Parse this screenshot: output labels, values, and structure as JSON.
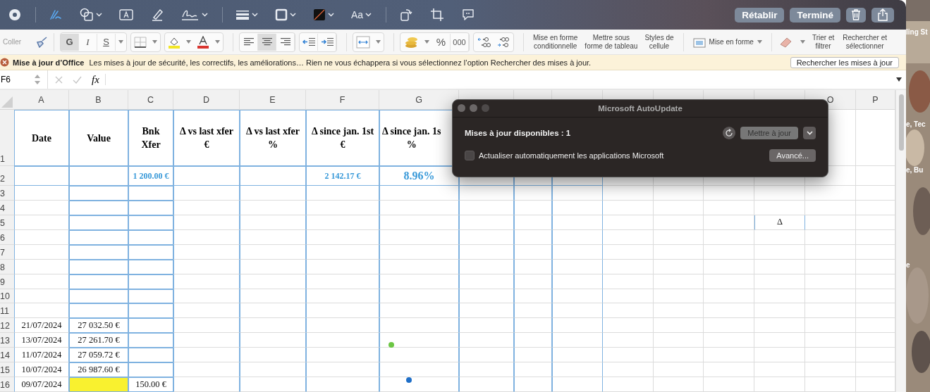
{
  "markup_toolbar": {
    "tools": [
      {
        "kind": "target",
        "selected": false,
        "menu": false
      },
      {
        "kind": "pen",
        "selected": true,
        "menu": false
      },
      {
        "kind": "shapes",
        "selected": false,
        "menu": true
      },
      {
        "kind": "textbox",
        "selected": false,
        "menu": false
      },
      {
        "kind": "highlighter",
        "selected": false,
        "menu": false
      },
      {
        "kind": "signature",
        "selected": false,
        "menu": true
      },
      {
        "kind": "line-weight",
        "selected": false,
        "menu": true
      },
      {
        "kind": "border",
        "selected": false,
        "menu": true
      },
      {
        "kind": "fill",
        "selected": false,
        "menu": true
      },
      {
        "kind": "font",
        "label": "Aa",
        "selected": false,
        "menu": true
      },
      {
        "kind": "rotate",
        "selected": false,
        "menu": false
      },
      {
        "kind": "crop",
        "selected": false,
        "menu": false
      },
      {
        "kind": "comment",
        "selected": false,
        "menu": false
      }
    ],
    "actions": [
      {
        "label": "Rétablir"
      },
      {
        "label": "Terminé"
      }
    ]
  },
  "ribbon": {
    "paste": {
      "label": "Coller"
    },
    "font_styles": [
      {
        "label": "G",
        "selected": true
      },
      {
        "label": "I",
        "selected": false
      },
      {
        "label": "S",
        "selected": false
      }
    ],
    "alignments": [
      {
        "kind": "left",
        "selected": false
      },
      {
        "kind": "center",
        "selected": true
      },
      {
        "kind": "right",
        "selected": false
      }
    ],
    "number_buttons": [
      "%",
      "000"
    ],
    "style_buttons": [
      {
        "label": "Mise en forme\nconditionnelle"
      },
      {
        "label": "Mettre sous\nforme de tableau"
      },
      {
        "label": "Styles de\ncellule"
      }
    ],
    "format_menu": {
      "label": "Mise en forme"
    },
    "edit_buttons": [
      {
        "label": "Trier et\nfiltrer"
      },
      {
        "label": "Rechercher et\nsélectionner"
      }
    ]
  },
  "banner": {
    "title": "Mise à jour d’Office",
    "message": "Les mises à jour de sécurité, les correctifs, les améliorations… Rien ne vous échappera si vous sélectionnez l’option Rechercher des mises à jour.",
    "button": "Rechercher les mises à jour"
  },
  "formula_bar": {
    "cell_ref": "F6",
    "function_label": "fx"
  },
  "sheet": {
    "columns_left": [
      "A",
      "B",
      "C",
      "D",
      "E",
      "F",
      "G"
    ],
    "columns_right": [
      "O",
      "P"
    ],
    "rows": [
      {
        "number": "1",
        "kind": "header",
        "cells": [
          {
            "text": "Date"
          },
          {
            "text": "Value"
          },
          {
            "text": "Bnk\nXfer"
          },
          {
            "text": "Δ vs last xfer\n€"
          },
          {
            "text": "Δ vs last xfer\n%"
          },
          {
            "text": "Δ since jan. 1st\n€"
          },
          {
            "text": "Δ since jan. 1s\n%"
          }
        ]
      },
      {
        "number": "2",
        "kind": "totals",
        "cells": [
          null,
          null,
          {
            "text": "1 200.00 €"
          },
          null,
          null,
          {
            "text": "2 142.17 €"
          },
          {
            "text": "8.96%",
            "emphasis": true
          }
        ]
      },
      {
        "number": "3",
        "kind": "data",
        "cells": []
      },
      {
        "number": "4",
        "kind": "data",
        "cells": []
      },
      {
        "number": "5",
        "kind": "data",
        "cells": [
          null,
          null,
          null,
          null,
          null,
          null,
          null,
          null,
          null,
          null,
          null,
          null,
          null,
          {
            "text": "Δ"
          }
        ]
      },
      {
        "number": "6",
        "kind": "data",
        "cells": []
      },
      {
        "number": "7",
        "kind": "data",
        "cells": []
      },
      {
        "number": "8",
        "kind": "data",
        "cells": []
      },
      {
        "number": "9",
        "kind": "data",
        "cells": []
      },
      {
        "number": "10",
        "kind": "data",
        "cells": []
      },
      {
        "number": "11",
        "kind": "data",
        "cells": []
      },
      {
        "number": "12",
        "kind": "data",
        "cells": [
          {
            "text": "21/07/2024"
          },
          {
            "text": "27 032.50 €"
          }
        ]
      },
      {
        "number": "13",
        "kind": "data",
        "cells": [
          {
            "text": "13/07/2024"
          },
          {
            "text": "27 261.70 €"
          }
        ]
      },
      {
        "number": "14",
        "kind": "data",
        "cells": [
          {
            "text": "11/07/2024"
          },
          {
            "text": "27 059.72 €"
          }
        ]
      },
      {
        "number": "15",
        "kind": "data",
        "cells": [
          {
            "text": "10/07/2024"
          },
          {
            "text": "26 987.60 €"
          }
        ]
      },
      {
        "number": "16",
        "kind": "data",
        "cells": [
          {
            "text": "09/07/2024"
          },
          {
            "highlighted": true
          },
          {
            "text": "150.00 €"
          }
        ]
      }
    ],
    "markers": [
      {
        "color": "#6cc644"
      },
      {
        "color": "#1f6fc8"
      }
    ]
  },
  "dialog": {
    "title": "Microsoft AutoUpdate",
    "heading": "Mises à jour disponibles : 1",
    "update_button": "Mettre à jour",
    "auto_update": {
      "label": "Actualiser automatiquement les applications Microsoft",
      "checked": false
    },
    "advanced_button": "Avancé..."
  },
  "desktop": {
    "texts": [
      "ling St",
      "e, Tec",
      "e, Bu",
      "e"
    ]
  }
}
